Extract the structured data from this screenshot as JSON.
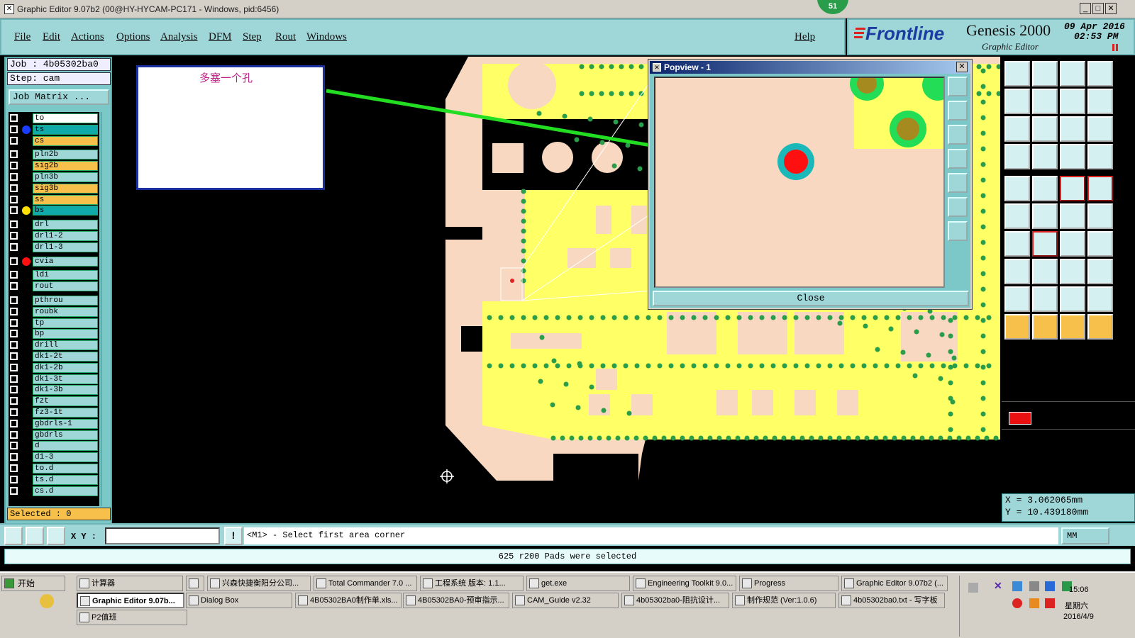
{
  "window": {
    "title": "Graphic Editor 9.07b2 (00@HY-HYCAM-PC171 - Windows, pid:6456)",
    "badge": "51"
  },
  "menu": {
    "items": [
      "File",
      "Edit",
      "Actions",
      "Options",
      "Analysis",
      "DFM",
      "Step",
      "Rout",
      "Windows"
    ],
    "help": "Help"
  },
  "brand": {
    "logo": "Frontline",
    "product": "Genesis 2000",
    "subtitle": "Graphic Editor",
    "date": "09 Apr 2016",
    "time": "02:53 PM"
  },
  "job": {
    "job_label": "Job : 4b05302ba0",
    "step_label": "Step: cam",
    "matrix_button": "Job Matrix ..."
  },
  "layers": [
    {
      "name": "to",
      "color": "#ffffff",
      "dot": ""
    },
    {
      "name": "ts",
      "color": "#1aa",
      "dot": "#1a3cff"
    },
    {
      "name": "cs",
      "color": "#f7c04a",
      "dot": ""
    },
    {
      "name": "pln2b",
      "color": "#9fd6d8",
      "dot": ""
    },
    {
      "name": "sig2b",
      "color": "#f7c04a",
      "dot": ""
    },
    {
      "name": "pln3b",
      "color": "#9fd6d8",
      "dot": ""
    },
    {
      "name": "sig3b",
      "color": "#f7c04a",
      "dot": ""
    },
    {
      "name": "ss",
      "color": "#f7c04a",
      "dot": ""
    },
    {
      "name": "bs",
      "color": "#1aa",
      "dot": "#ffe000"
    },
    {
      "name": "drl",
      "color": "#9fd6d8",
      "dot": ""
    },
    {
      "name": "drl1-2",
      "color": "#9fd6d8",
      "dot": ""
    },
    {
      "name": "drl1-3",
      "color": "#9fd6d8",
      "dot": ""
    },
    {
      "name": "cvia",
      "color": "#9fd6d8",
      "dot": "#ff1010"
    },
    {
      "name": "ldi",
      "color": "#9fd6d8",
      "dot": ""
    },
    {
      "name": "rout",
      "color": "#9fd6d8",
      "dot": ""
    },
    {
      "name": "pthrou",
      "color": "#9fd6d8",
      "dot": ""
    },
    {
      "name": "roubk",
      "color": "#9fd6d8",
      "dot": ""
    },
    {
      "name": "tp",
      "color": "#9fd6d8",
      "dot": ""
    },
    {
      "name": "bp",
      "color": "#9fd6d8",
      "dot": ""
    },
    {
      "name": "drill",
      "color": "#9fd6d8",
      "dot": ""
    },
    {
      "name": "dk1-2t",
      "color": "#9fd6d8",
      "dot": ""
    },
    {
      "name": "dk1-2b",
      "color": "#9fd6d8",
      "dot": ""
    },
    {
      "name": "dk1-3t",
      "color": "#9fd6d8",
      "dot": ""
    },
    {
      "name": "dk1-3b",
      "color": "#9fd6d8",
      "dot": ""
    },
    {
      "name": "fzt",
      "color": "#9fd6d8",
      "dot": ""
    },
    {
      "name": "fz3-1t",
      "color": "#9fd6d8",
      "dot": ""
    },
    {
      "name": "gbdrls-1",
      "color": "#9fd6d8",
      "dot": ""
    },
    {
      "name": "gbdrls",
      "color": "#9fd6d8",
      "dot": ""
    },
    {
      "name": "d",
      "color": "#9fd6d8",
      "dot": ""
    },
    {
      "name": "d1-3",
      "color": "#9fd6d8",
      "dot": ""
    },
    {
      "name": "to.d",
      "color": "#9fd6d8",
      "dot": ""
    },
    {
      "name": "ts.d",
      "color": "#9fd6d8",
      "dot": ""
    },
    {
      "name": "cs.d",
      "color": "#9fd6d8",
      "dot": ""
    }
  ],
  "selected": "Selected : 0",
  "annotation": {
    "text": "多塞一个孔"
  },
  "popview": {
    "title": "Popview - 1",
    "close": "Close"
  },
  "coords": {
    "x": "X = 3.062065mm",
    "y": "Y = 10.439180mm"
  },
  "command": {
    "xy_label": "X Y :",
    "xy_value": "",
    "prompt": "<M1> - Select first area corner",
    "units": "MM"
  },
  "status": "625 r200 Pads were selected",
  "taskbar": {
    "start": "开始",
    "row1": [
      "计算器",
      "",
      "兴森快捷衡阳分公司...",
      "Total Commander 7.0 ...",
      "工程系统  版本: 1.1...",
      "get.exe",
      "Engineering Toolkit 9.0...",
      "Progress",
      "Graphic Editor 9.07b2 (..."
    ],
    "row2": [
      "Graphic Editor 9.07b...",
      "Dialog Box",
      "4B05302BA0制作单.xls...",
      "4B05302BA0-预审指示...",
      "CAM_Guide v2.32",
      "4b05302ba0-阻抗设计...",
      "制作规范 (Ver:1.0.6)",
      "4b05302ba0.txt - 写字板"
    ],
    "row3": [
      "P2值班"
    ],
    "clock": {
      "time": "15:06",
      "weekday": "星期六",
      "date": "2016/4/9"
    }
  },
  "colors": {
    "panel": "#9fd6d8",
    "copper": "#ffff66",
    "board": "#f8d8c0",
    "highlight": "#ff1010",
    "arrow": "#22dd22"
  }
}
